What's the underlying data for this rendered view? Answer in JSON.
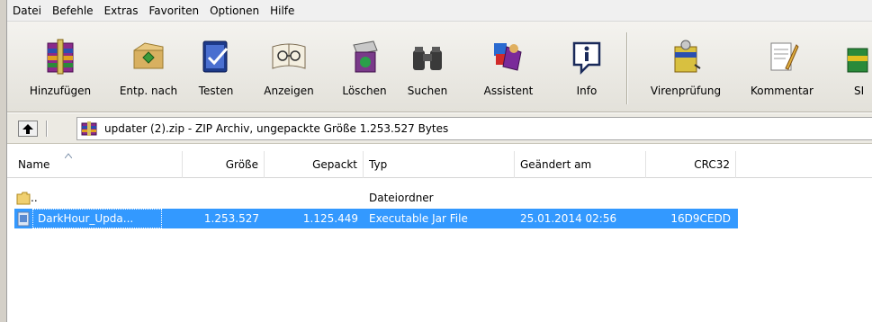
{
  "menu": [
    "Datei",
    "Befehle",
    "Extras",
    "Favoriten",
    "Optionen",
    "Hilfe"
  ],
  "toolbar": {
    "buttons": [
      {
        "label": "Hinzufügen",
        "icon": "add-archive-icon"
      },
      {
        "label": "Entp. nach",
        "icon": "extract-to-icon"
      },
      {
        "label": "Testen",
        "icon": "test-archive-icon"
      },
      {
        "label": "Anzeigen",
        "icon": "view-file-icon"
      },
      {
        "label": "Löschen",
        "icon": "delete-icon"
      },
      {
        "label": "Suchen",
        "icon": "find-binoculars-icon"
      },
      {
        "label": "Assistent",
        "icon": "wizard-icon"
      },
      {
        "label": "Info",
        "icon": "info-icon"
      },
      {
        "label": "Virenprüfung",
        "icon": "virus-scan-icon"
      },
      {
        "label": "Kommentar",
        "icon": "comment-icon"
      },
      {
        "label": "SI",
        "icon": "sfx-icon"
      }
    ]
  },
  "address": {
    "text": "updater (2).zip - ZIP Archiv, ungepackte Größe 1.253.527 Bytes",
    "dropdown_glyph": "▾"
  },
  "columns": [
    "Name",
    "Größe",
    "Gepackt",
    "Typ",
    "Geändert am",
    "CRC32"
  ],
  "rows": [
    {
      "name": "..",
      "size": "",
      "packed": "",
      "type": "Dateiordner",
      "modified": "",
      "crc": ""
    },
    {
      "name": "DarkHour_Upda...",
      "size": "1.253.527",
      "packed": "1.125.449",
      "type": "Executable Jar File",
      "modified": "25.01.2014 02:56",
      "crc": "16D9CEDD"
    }
  ],
  "colors": {
    "selection": "#3399ff",
    "window_bg": "#f0f0f0"
  }
}
